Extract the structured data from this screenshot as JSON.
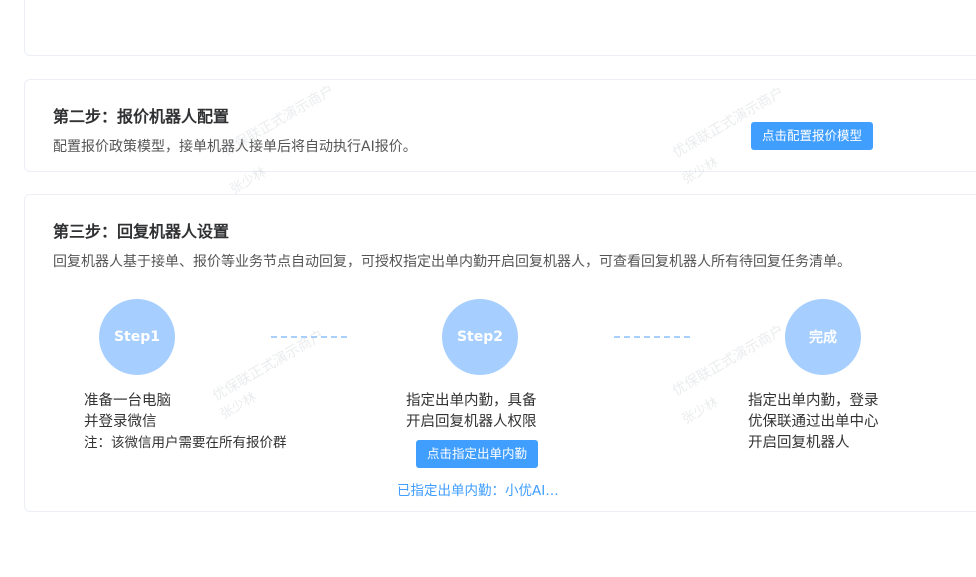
{
  "step2": {
    "title": "第二步：报价机器人配置",
    "desc": "配置报价政策模型，接单机器人接单后将自动执行AI报价。",
    "button": "点击配置报价模型"
  },
  "step3": {
    "title": "第三步：回复机器人设置",
    "desc": "回复机器人基于接单、报价等业务节点自动回复，可授权指定出单内勤开启回复机器人，可查看回复机器人所有待回复任务清单。",
    "steps": [
      {
        "badge": "Step1",
        "lines": [
          "准备一台电脑",
          "并登录微信"
        ],
        "note": "注：该微信用户需要在所有报价群"
      },
      {
        "badge": "Step2",
        "lines": [
          "指定出单内勤，具备",
          "开启回复机器人权限"
        ],
        "button": "点击指定出单内勤",
        "status": "已指定出单内勤：小优AI…"
      },
      {
        "badge": "完成",
        "lines": [
          "指定出单内勤，登录",
          "优保联通过出单中心",
          "开启回复机器人"
        ]
      }
    ]
  },
  "watermark": {
    "line1": "优保联正式演示商户",
    "line2": "张少林"
  }
}
